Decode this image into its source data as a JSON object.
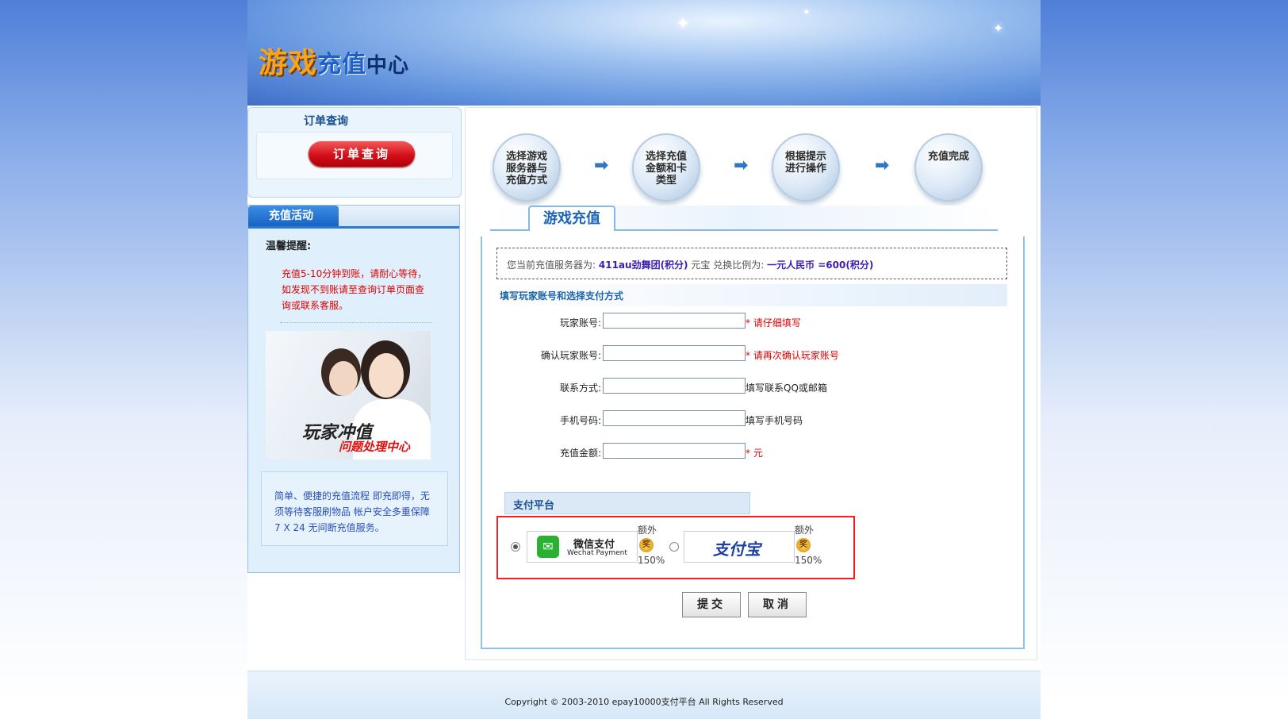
{
  "header": {
    "logo_part1": "游戏",
    "logo_part2": "充值",
    "logo_part3": "中心"
  },
  "sidebar": {
    "order_title": "订单查询",
    "order_button": "订单查询",
    "promo_title": "充值活动",
    "tip_label": "温馨提醒:",
    "tip_text": "充值5-10分钟到账，请耐心等待，如发现不到账请至查询订单页面查询或联系客服。",
    "image_text1": "玩家冲值",
    "image_text2": "问题处理中心",
    "desc_text": "简单、便捷的充值流程 即充即得，无须等待客服刷物品 帐户安全多重保障 7 X 24 无间断充值服务。"
  },
  "steps": [
    {
      "label": "选择游戏服务器与充值方式"
    },
    {
      "label": "选择充值金额和卡类型"
    },
    {
      "label": "根据提示进行操作"
    },
    {
      "label": "充值完成"
    }
  ],
  "step_arrow": "➡",
  "main": {
    "tab_label": "游戏充值",
    "server_prefix": "您当前充值服务器为:",
    "server_value": "411au劲舞团(积分)",
    "ratio_prefix": "元宝 兑换比例为:",
    "ratio_value": "一元人民币 =600(积分)",
    "section_title": "填写玩家账号和选择支付方式",
    "fields": [
      {
        "label": "玩家账号:",
        "value": "",
        "hint_req": "* ",
        "hint": "请仔细填写",
        "hint_red": true
      },
      {
        "label": "确认玩家账号:",
        "value": "",
        "hint_req": "* ",
        "hint": "请再次确认玩家账号",
        "hint_red": true
      },
      {
        "label": "联系方式:",
        "value": "",
        "hint_req": "",
        "hint": "填写联系QQ或邮箱",
        "hint_red": false
      },
      {
        "label": "手机号码:",
        "value": "",
        "hint_req": "",
        "hint": "填写手机号码",
        "hint_red": false
      },
      {
        "label": "充值金额:",
        "value": "",
        "hint_req": "* ",
        "hint": "元",
        "hint_red": true
      }
    ],
    "pay_title": "支付平台",
    "payments": [
      {
        "name_cn": "微信支付",
        "name_en": "Wechat Payment",
        "extra": "额外",
        "medal": "奖",
        "rate": "150%",
        "selected": true
      },
      {
        "name_cn": "支付宝",
        "extra": "额外",
        "medal": "奖",
        "rate": "150%",
        "selected": false
      }
    ],
    "submit_label": "提交",
    "cancel_label": "取消"
  },
  "footer": {
    "copyright": "Copyright © 2003-2010 epay10000支付平台 All Rights Reserved"
  },
  "colors": {
    "accent_blue": "#1c65b8",
    "alert_red": "#e00000",
    "value_purple": "#3b1cb4"
  }
}
